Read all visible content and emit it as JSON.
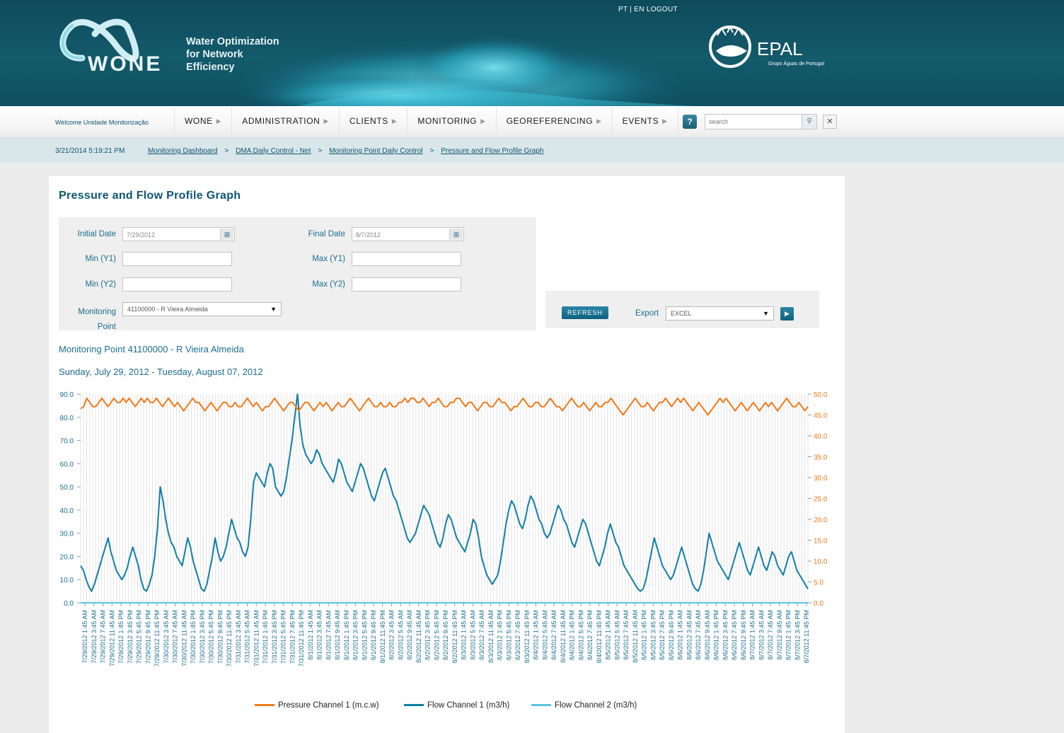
{
  "header": {
    "top_links": {
      "pt": "PT",
      "en": "EN",
      "logout": "LOGOUT"
    },
    "brand": "WONE",
    "tagline": [
      "Water Optimization",
      "for Network",
      "Efficiency"
    ],
    "partner": "EPAL",
    "partner_sub": "Grupo Águas de Portugal"
  },
  "nav": {
    "welcome": "Welcome Unidade Monitorização",
    "menu": [
      "WONE",
      "ADMINISTRATION",
      "CLIENTS",
      "MONITORING",
      "GEOREFERENCING",
      "EVENTS"
    ],
    "help_label": "?",
    "search_placeholder": "search",
    "search_icon": "search-icon",
    "close_icon": "close-icon"
  },
  "breadcrumb": {
    "datetime": "3/21/2014 5:19:21 PM",
    "items": [
      "Monitoring Dashboard",
      "DMA Daily Control - Net",
      "Monitoring Point Daily Control",
      "Pressure and Flow Profile Graph"
    ],
    "separator": ">"
  },
  "page": {
    "title": "Pressure and Flow Profile Graph",
    "filters": {
      "initial_date_label": "Initial Date",
      "initial_date_value": "7/29/2012",
      "final_date_label": "Final Date",
      "final_date_value": "8/7/2012",
      "min_y1_label": "Min (Y1)",
      "max_y1_label": "Max (Y1)",
      "min_y2_label": "Min (Y2)",
      "max_y2_label": "Max (Y2)",
      "monitoring_label_1": "Monitoring",
      "monitoring_label_2": "Point",
      "monitoring_value": "41100000 - R Vieira Almeida"
    },
    "actions": {
      "refresh": "REFRESH",
      "export_label": "Export",
      "export_value": "EXCEL"
    },
    "monitoring_point_line": "Monitoring Point 41100000 - R Vieira Almeida",
    "date_range_line": "Sunday, July 29, 2012 - Tuesday, August 07, 2012"
  },
  "chart_data": {
    "type": "line",
    "y1_ticks": [
      "90.0",
      "80.0",
      "70.0",
      "60.0",
      "50.0",
      "40.0",
      "30.0",
      "20.0",
      "10.0",
      "0.0"
    ],
    "y2_ticks": [
      "50.0",
      "45.0",
      "40.0",
      "35.0",
      "30.0",
      "25.0",
      "20.0",
      "15.0",
      "10.0",
      "5.0",
      "0.0"
    ],
    "y1lim": [
      0,
      90
    ],
    "y2lim": [
      0,
      50
    ],
    "grid": true,
    "legend_placement": "bottom-center",
    "x_labels": [
      "7/29/2012 1:45 AM",
      "7/29/2012 3:45 AM",
      "7/29/2012 7:45 AM",
      "7/29/2012 11:45 AM",
      "7/29/2012 1:45 PM",
      "7/29/2012 3:45 PM",
      "7/29/2012 5:45 PM",
      "7/29/2012 9:45 PM",
      "7/29/2012 11:45 PM",
      "7/30/2012 3:45 AM",
      "7/30/2012 7:45 AM",
      "7/30/2012 11:45 AM",
      "7/30/2012 1:45 PM",
      "7/30/2012 3:45 PM",
      "7/30/2012 5:45 PM",
      "7/30/2012 9:45 PM",
      "7/30/2012 11:45 PM",
      "7/31/2012 3:45 AM",
      "7/31/2012 5:45 AM",
      "7/31/2012 11:45 AM",
      "7/31/2012 1:45 PM",
      "7/31/2012 3:45 PM",
      "7/31/2012 5:45 PM",
      "7/31/2012 7:45 PM",
      "7/31/2012 11:45 PM",
      "8/1/2012 1:45 AM",
      "8/1/2012 3:45 AM",
      "8/1/2012 7:45 AM",
      "8/1/2012 9:45 AM",
      "8/1/2012 1:45 PM",
      "8/1/2012 3:45 PM",
      "8/1/2012 5:45 PM",
      "8/1/2012 9:45 PM",
      "8/1/2012 11:45 PM",
      "8/2/2012 3:45 AM",
      "8/2/2012 5:45 AM",
      "8/2/2012 9:45 AM",
      "8/2/2012 11:45 AM",
      "8/2/2012 3:45 PM",
      "8/2/2012 5:45 PM",
      "8/2/2012 9:45 PM",
      "8/2/2012 11:45 PM",
      "8/3/2012 1:45 AM",
      "8/3/2012 5:45 AM",
      "8/3/2012 7:45 AM",
      "8/3/2012 11:45 AM",
      "8/3/2012 1:45 PM",
      "8/3/2012 5:45 PM",
      "8/3/2012 7:45 PM",
      "8/3/2012 11:45 PM",
      "8/4/2012 1:45 AM",
      "8/4/2012 5:45 AM",
      "8/4/2012 7:45 AM",
      "8/4/2012 11:45 AM",
      "8/4/2012 1:45 PM",
      "8/4/2012 5:45 PM",
      "8/4/2012 7:45 PM",
      "8/4/2012 11:45 PM",
      "8/5/2012 1:45 AM",
      "8/5/2012 5:45 AM",
      "8/5/2012 7:45 AM",
      "8/5/2012 11:45 AM",
      "8/5/2012 1:45 PM",
      "8/5/2012 3:45 PM",
      "8/5/2012 7:45 PM",
      "8/5/2012 9:45 PM",
      "8/6/2012 1:45 AM",
      "8/6/2012 3:45 AM",
      "8/6/2012 7:45 AM",
      "8/6/2012 9:45 AM",
      "8/6/2012 1:45 PM",
      "8/6/2012 3:45 PM",
      "8/6/2012 7:45 PM",
      "8/6/2012 9:45 PM",
      "8/7/2012 1:45 AM",
      "8/7/2012 3:45 AM",
      "8/7/2012 7:45 AM",
      "8/7/2012 9:45 AM",
      "8/7/2012 1:45 PM",
      "8/7/2012 3:45 PM",
      "8/7/2012 11:45 PM"
    ],
    "series": [
      {
        "name": "Pressure Channel 1 (m.c.w)",
        "axis": "y2",
        "color": "#f07a1a",
        "values": [
          46.5,
          47,
          49,
          48,
          47,
          47,
          48,
          49,
          48,
          47,
          48,
          49,
          48,
          48,
          49,
          48,
          49,
          48,
          47,
          48,
          49,
          48,
          49,
          48,
          48,
          49,
          48,
          47,
          48,
          49,
          48,
          47,
          48,
          47,
          46,
          47,
          48,
          49,
          48,
          48,
          47,
          46,
          47,
          48,
          47,
          46,
          47,
          48,
          48,
          47,
          47,
          48,
          47,
          47,
          48,
          49,
          48,
          47,
          48,
          47,
          46,
          47,
          47,
          48,
          49,
          48,
          47,
          46,
          47,
          48,
          48,
          47,
          46,
          47,
          48,
          48,
          47,
          46,
          47,
          48,
          47,
          48,
          47,
          46,
          47,
          48,
          47,
          47,
          48,
          49,
          48,
          47,
          46,
          47,
          48,
          49,
          48,
          47,
          47,
          48,
          47,
          47,
          48,
          47,
          47,
          48,
          48,
          49,
          48,
          49,
          49,
          48,
          48,
          49,
          48,
          47,
          48,
          48,
          49,
          48,
          47,
          47,
          48,
          48,
          49,
          49,
          48,
          47,
          48,
          48,
          47,
          46,
          47,
          48,
          48,
          47,
          47,
          48,
          49,
          48,
          48,
          47,
          46,
          47,
          47,
          48,
          49,
          48,
          47,
          47,
          48,
          48,
          47,
          47,
          48,
          49,
          48,
          47,
          47,
          46,
          47,
          48,
          49,
          48,
          47,
          47,
          48,
          47,
          46,
          47,
          48,
          47,
          47,
          48,
          48,
          49,
          48,
          47,
          46,
          45,
          46,
          47,
          48,
          49,
          48,
          47,
          47,
          48,
          47,
          46,
          47,
          48,
          48,
          49,
          48,
          47,
          48,
          49,
          48,
          49,
          48,
          47,
          46,
          47,
          48,
          47,
          46,
          45,
          46,
          47,
          48,
          49,
          48,
          49,
          48,
          47,
          46,
          47,
          48,
          47,
          46,
          47,
          48,
          47,
          46,
          47,
          48,
          47,
          48,
          47,
          46,
          47,
          48,
          49,
          48,
          47,
          47,
          48,
          47,
          46,
          47
        ]
      },
      {
        "name": "Flow Channel 1 (m3/h)",
        "axis": "y1",
        "color": "#0f7fa3",
        "values": [
          16,
          14,
          10,
          7,
          5,
          8,
          12,
          16,
          20,
          24,
          28,
          22,
          18,
          14,
          12,
          10,
          12,
          15,
          20,
          24,
          20,
          16,
          10,
          6,
          5,
          8,
          12,
          20,
          32,
          50,
          44,
          36,
          30,
          26,
          24,
          20,
          18,
          16,
          22,
          28,
          24,
          18,
          14,
          10,
          6,
          5,
          8,
          14,
          20,
          28,
          22,
          18,
          20,
          24,
          30,
          36,
          32,
          28,
          26,
          22,
          20,
          24,
          36,
          52,
          56,
          54,
          52,
          50,
          56,
          60,
          58,
          50,
          48,
          46,
          48,
          54,
          62,
          70,
          80,
          90,
          76,
          68,
          64,
          62,
          60,
          62,
          66,
          64,
          60,
          58,
          56,
          54,
          52,
          56,
          62,
          60,
          56,
          52,
          50,
          48,
          52,
          56,
          60,
          58,
          54,
          50,
          46,
          44,
          48,
          52,
          56,
          58,
          54,
          50,
          46,
          44,
          40,
          36,
          32,
          28,
          26,
          28,
          30,
          34,
          38,
          42,
          40,
          38,
          34,
          30,
          26,
          24,
          28,
          34,
          38,
          36,
          32,
          28,
          26,
          24,
          22,
          26,
          30,
          36,
          34,
          28,
          20,
          16,
          12,
          10,
          8,
          10,
          12,
          18,
          26,
          34,
          40,
          44,
          42,
          38,
          34,
          32,
          36,
          42,
          46,
          44,
          40,
          36,
          34,
          30,
          28,
          30,
          34,
          38,
          42,
          40,
          36,
          34,
          30,
          26,
          24,
          28,
          32,
          36,
          34,
          30,
          26,
          22,
          18,
          16,
          20,
          24,
          30,
          34,
          30,
          26,
          24,
          20,
          16,
          14,
          12,
          10,
          8,
          6,
          5,
          6,
          10,
          16,
          22,
          28,
          24,
          20,
          16,
          14,
          12,
          10,
          12,
          16,
          20,
          24,
          20,
          16,
          12,
          8,
          6,
          5,
          8,
          14,
          22,
          30,
          26,
          22,
          18,
          16,
          14,
          12,
          10,
          14,
          18,
          22,
          26,
          22,
          18,
          14,
          12,
          16,
          20,
          24,
          20,
          16,
          14,
          18,
          22,
          20,
          16,
          14,
          12,
          16,
          20,
          22,
          18,
          14,
          12,
          10,
          8,
          6
        ]
      },
      {
        "name": "Flow Channel 2 (m3/h)",
        "axis": "y1",
        "color": "#5bc2e6",
        "values": [
          0,
          0,
          0,
          0,
          0,
          0,
          0,
          0,
          0,
          0,
          0,
          0,
          0,
          0,
          0,
          0,
          0,
          0,
          0,
          0,
          0,
          0,
          0,
          0,
          0,
          0,
          0,
          0,
          0,
          0,
          0,
          0,
          0,
          0,
          0,
          0,
          0,
          0,
          0,
          0
        ]
      }
    ]
  }
}
